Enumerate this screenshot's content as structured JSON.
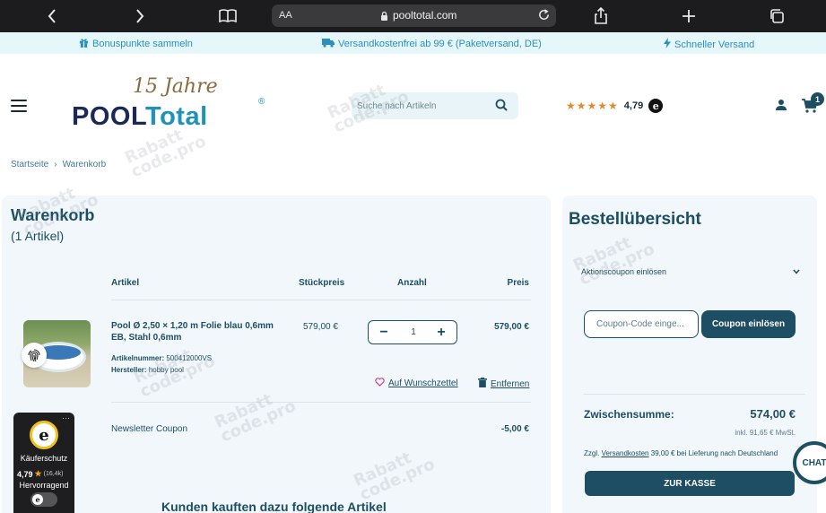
{
  "browser": {
    "text_size_label": "AA",
    "domain": "pooltotal.com",
    "icons": [
      "back-icon",
      "forward-icon",
      "book-icon",
      "share-icon",
      "new-tab-icon",
      "tabs-icon",
      "reload-icon",
      "lock-icon"
    ]
  },
  "benefits": [
    {
      "icon": "gift-icon",
      "label": "Bonuspunkte sammeln"
    },
    {
      "icon": "truck-icon",
      "label": "Versandkostenfrei ab 99 € (Paketversand, DE)"
    },
    {
      "icon": "bolt-icon",
      "label": "Schneller Versand"
    }
  ],
  "header": {
    "logo_script": "15 Jahre",
    "logo_word1": "POOL",
    "logo_word2": "Total",
    "logo_reg": "®",
    "search_placeholder": "Suche nach Artikeln",
    "rating_stars": "★★★★★",
    "rating_value": "4,79",
    "rating_badge": "e",
    "cart_count": "1"
  },
  "breadcrumb": {
    "home": "Startseite",
    "sep": "›",
    "current": "Warenkorb"
  },
  "cart": {
    "title": "Warenkorb",
    "count_label": "(1 Artikel)",
    "columns": {
      "article": "Artikel",
      "unit_price": "Stückpreis",
      "quantity": "Anzahl",
      "price": "Preis"
    },
    "item": {
      "name": "Pool Ø 2,50 × 1,20 m Folie blau 0,6mm EB, Stahl 0,6mm",
      "sku_label": "Artikelnummer:",
      "sku": "500412000VS",
      "maker_label": "Hersteller:",
      "maker": "hobby pool",
      "unit_price": "579,00 €",
      "quantity": "1",
      "price": "579,00 €",
      "wishlist_label": "Auf Wunschzettel",
      "remove_label": "Entfernen"
    },
    "coupon_line": {
      "label": "Newsletter Coupon",
      "amount": "-5,00 €"
    },
    "cross_sell_title": "Kunden kauften dazu folgende Artikel"
  },
  "trusted_shops": {
    "seal_letter": "e",
    "label": "Käuferschutz",
    "score": "4,79",
    "star": "★",
    "review_count": "(16,4k)",
    "grade": "Hervorragend",
    "menu": "···"
  },
  "summary": {
    "title": "Bestellübersicht",
    "coupon_toggle": "Aktionscoupon einlösen",
    "coupon_placeholder": "Coupon-Code einge...",
    "coupon_button": "Coupon einlösen",
    "subtotal_label": "Zwischensumme:",
    "subtotal_value": "574,00 €",
    "vat_note": "inkl. 91,65 € MwSt.",
    "shipping_prefix": "Zzgl.",
    "shipping_link": "Versandkosten",
    "shipping_suffix": "39,00 € bei Lieferung nach Deutschland",
    "checkout_button": "ZUR KASSE"
  },
  "chat": {
    "label": "CHAT"
  },
  "watermark": {
    "line1": "Rabatt",
    "line2": "code.pro"
  },
  "colors": {
    "brand_dark": "#1d4e63",
    "brand_blue": "#1e92b8",
    "panel_bg": "#f1f7fa",
    "benefit_bg": "#e6f7fb",
    "star": "#e08a2c"
  }
}
